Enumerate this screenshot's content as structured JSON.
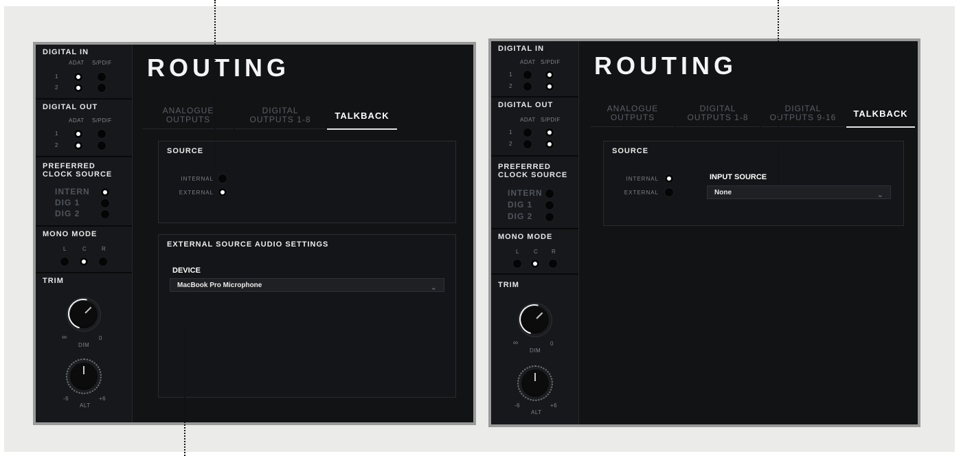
{
  "sidebar": {
    "digital_in": {
      "title": "DIGITAL IN",
      "col1": "ADAT",
      "col2": "S/PDIF",
      "rows": [
        "1",
        "2"
      ]
    },
    "digital_out": {
      "title": "DIGITAL OUT",
      "col1": "ADAT",
      "col2": "S/PDIF",
      "rows": [
        "1",
        "2"
      ]
    },
    "clock": {
      "title_line1": "PREFERRED",
      "title_line2": "CLOCK SOURCE",
      "options": [
        "INTERN",
        "DIG 1",
        "DIG 2"
      ]
    },
    "mono": {
      "title": "MONO MODE",
      "labels": [
        "L",
        "C",
        "R"
      ]
    },
    "trim": {
      "title": "TRIM",
      "dim_label": "DIM",
      "dim_min": "∞",
      "dim_max": "0",
      "alt_label": "ALT",
      "alt_min": "-6",
      "alt_max": "+6"
    }
  },
  "panel_left": {
    "title": "ROUTING",
    "tabs": [
      "ANALOGUE\nOUTPUTS",
      "DIGITAL\nOUTPUTS 1-8",
      "TALKBACK"
    ],
    "active_tab": "TALKBACK",
    "source": {
      "title": "SOURCE",
      "internal": "INTERNAL",
      "external": "EXTERNAL",
      "selected": "EXTERNAL"
    },
    "ext": {
      "title": "EXTERNAL SOURCE AUDIO SETTINGS",
      "device_label": "DEVICE",
      "device_value": "MacBook Pro Microphone"
    }
  },
  "panel_right": {
    "title": "ROUTING",
    "tabs": [
      "ANALOGUE\nOUTPUTS",
      "DIGITAL\nOUTPUTS 1-8",
      "DIGITAL\nOUTPUTS 9-16",
      "TALKBACK"
    ],
    "active_tab": "TALKBACK",
    "source": {
      "title": "SOURCE",
      "internal": "INTERNAL",
      "external": "EXTERNAL",
      "selected": "INTERNAL",
      "input_source_label": "INPUT SOURCE",
      "input_source_value": "None"
    }
  },
  "icons": {
    "dropdown": "chevron-down-icon",
    "radio": "radio-icon",
    "knob": "rotary-knob-icon"
  },
  "colors": {
    "panel_bg": "#121315",
    "sidebar_bg": "#17181b",
    "accent": "#ffffff",
    "frame": "#9a9a9a",
    "outer_bg": "#ebecea"
  }
}
